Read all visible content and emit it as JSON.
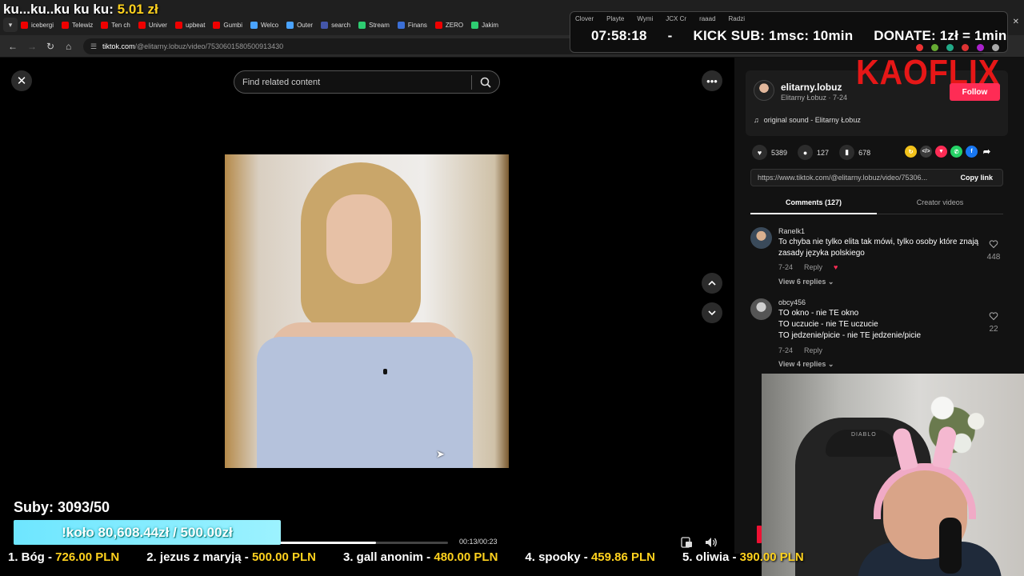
{
  "browser": {
    "tabs": [
      {
        "label": "icebergi",
        "color": "#e00"
      },
      {
        "label": "Telewiz",
        "color": "#e00"
      },
      {
        "label": "Ten ch",
        "color": "#e00"
      },
      {
        "label": "Univer",
        "color": "#e00"
      },
      {
        "label": "upbeat",
        "color": "#e00"
      },
      {
        "label": "Gumbi",
        "color": "#e00"
      },
      {
        "label": "Welco",
        "color": "#4aa3ff"
      },
      {
        "label": "Outer",
        "color": "#4aa3ff"
      },
      {
        "label": "search",
        "color": "#4456aa"
      },
      {
        "label": "Stream",
        "color": "#2ecc71"
      },
      {
        "label": "Finans",
        "color": "#3b6fd6"
      },
      {
        "label": "ZERO",
        "color": "#e00"
      },
      {
        "label": "Jakim",
        "color": "#2ecc71"
      }
    ],
    "url_host": "tiktok.com",
    "url_path": "/@elitarny.lobuz/video/7530601580500913430"
  },
  "overlay": {
    "title_text": "ku...ku..ku ku ku:",
    "title_amount": "5.01 zł",
    "timer": "07:58:18",
    "timer_sep": "-",
    "kick_sub": "KICK SUB: 1msc: 10min",
    "donate": "DONATE: 1zł = 1min",
    "mini_tabs": [
      "Clover",
      "Playte",
      "Wymi",
      "JCX Cr",
      "raaad",
      "Radzi"
    ],
    "brand": "KAOFLIX",
    "suby": "Suby: 3093/50",
    "kolo": "!koło 80,608.44zł / 500.00zł",
    "leaderboard": [
      {
        "rank_name": "1. Bóg - ",
        "amount": "726.00 PLN"
      },
      {
        "rank_name": "2. jezus z maryją - ",
        "amount": "500.00 PLN"
      },
      {
        "rank_name": "3. gall anonim - ",
        "amount": "480.00 PLN"
      },
      {
        "rank_name": "4. spooky - ",
        "amount": "459.86 PLN"
      },
      {
        "rank_name": "5. oliwia - ",
        "amount": "390.00 PLN"
      }
    ]
  },
  "tiktok": {
    "search_placeholder": "Find related content",
    "video": {
      "time": "00:13/00:23",
      "progress_fraction": 0.57
    },
    "author": {
      "username": "elitarny.lobuz",
      "display": "Elitarny Łobuz · 7-24",
      "follow_label": "Follow"
    },
    "sound": "original sound - Elitarny Łobuz",
    "stats": {
      "likes": "5389",
      "comments": "127",
      "saves": "678"
    },
    "link": {
      "url": "https://www.tiktok.com/@elitarny.lobuz/video/75306...",
      "copy_label": "Copy link"
    },
    "tabs": {
      "comments": "Comments (127)",
      "creator": "Creator videos"
    },
    "comments": [
      {
        "user": "Ranelk1",
        "lines": [
          "To chyba nie tylko elita tak mówi, tylko osoby które znają zasady języka polskiego"
        ],
        "date": "7-24",
        "reply": "Reply",
        "replies": "View 6 replies",
        "likes": "448"
      },
      {
        "user": "obcy456",
        "lines": [
          "TO okno - nie TE okno",
          "TO uczucie - nie TE uczucie",
          "TO jedzenie/picie - nie TE jedzenie/picie"
        ],
        "date": "7-24",
        "reply": "Reply",
        "replies": "View 4 replies",
        "likes": "22"
      }
    ]
  },
  "webcam": {
    "chair_brand": "DIABLO"
  },
  "colors": {
    "accent": "#fe2c55",
    "gold": "#ffd21e",
    "kick_cyan": "#6ee6ff"
  }
}
